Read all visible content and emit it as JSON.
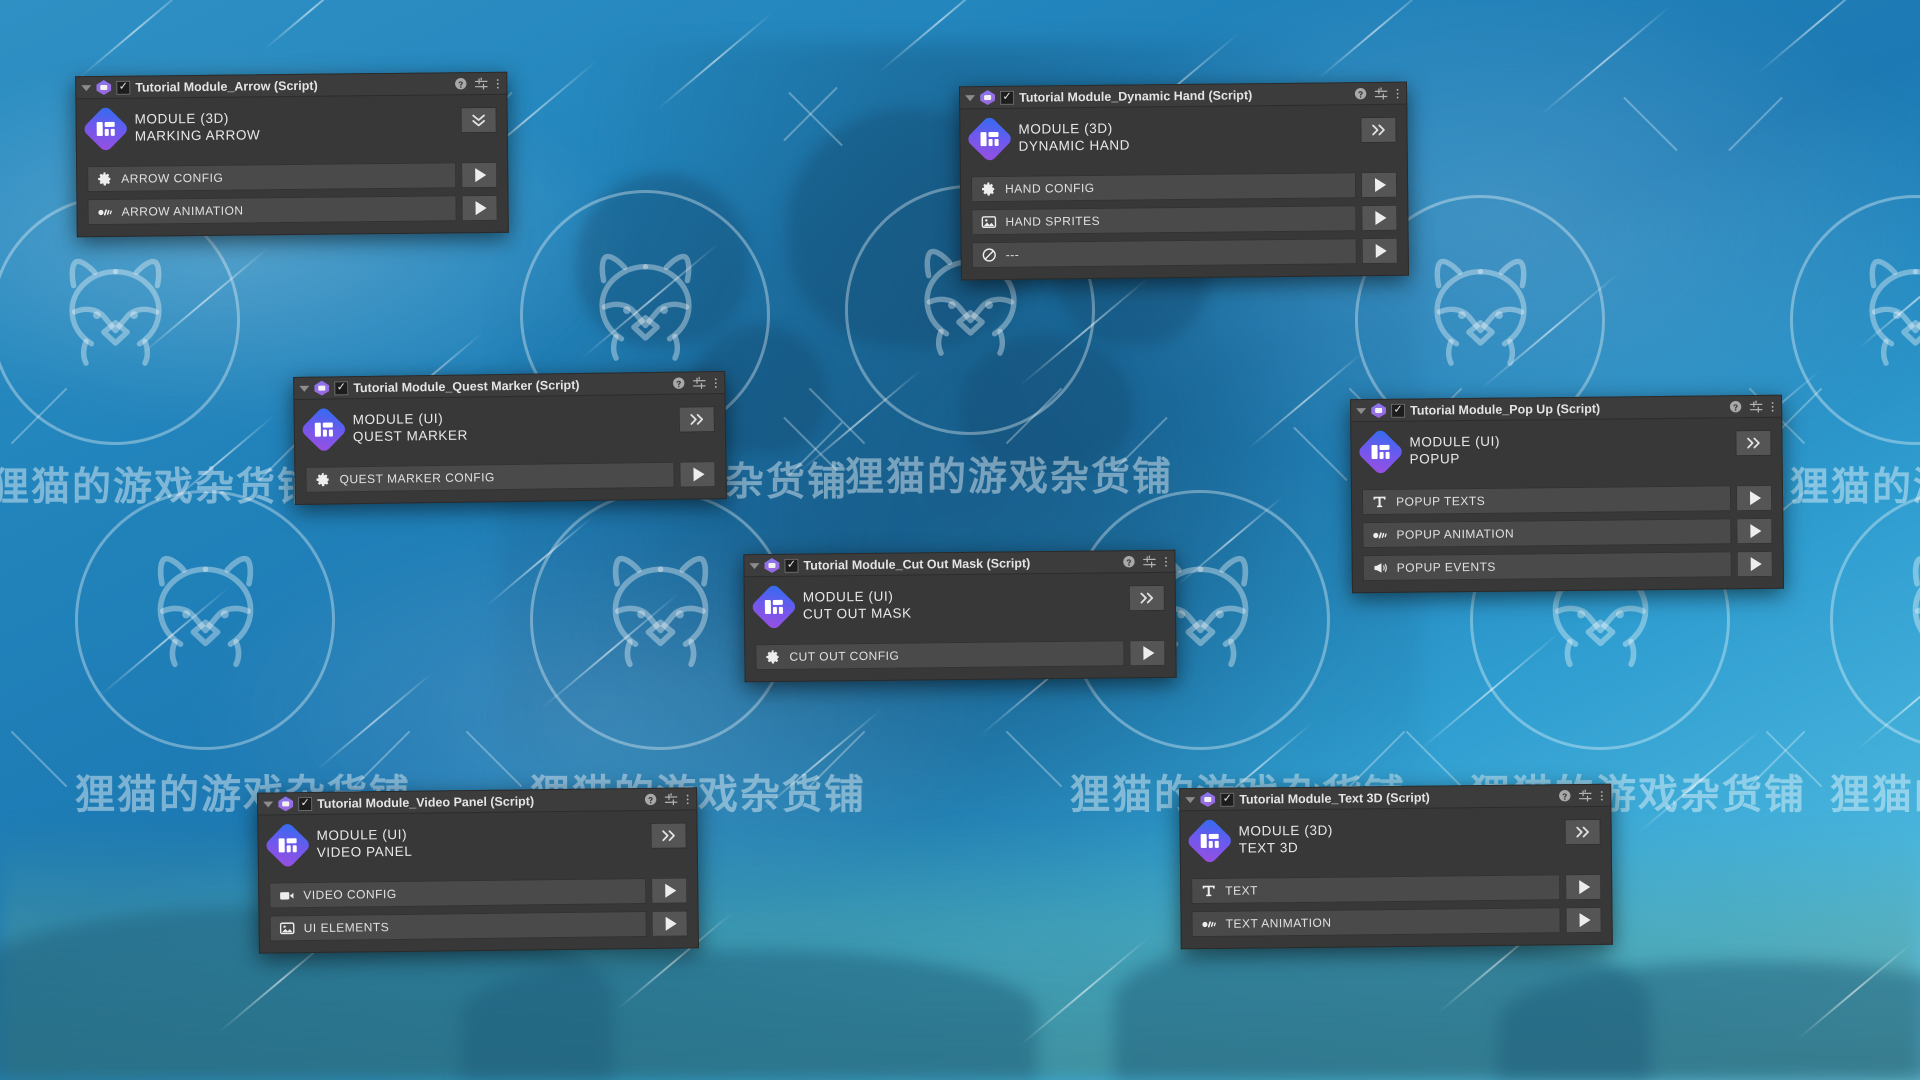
{
  "background": {
    "gradient_from": "#2f90c4",
    "gradient_to": "#6cc4df",
    "watermark_text": "狸猫的游戏杂货铺",
    "watermark_icon": "raccoon-face-icon"
  },
  "panels": [
    {
      "id": "arrow",
      "header": {
        "title": "Tutorial Module_Arrow (Script)",
        "enabled_check": "✓",
        "help_icon": "help-icon",
        "preset_icon": "preset-sliders-icon",
        "menu_icon": "kebab-menu-icon"
      },
      "module": {
        "kind": "MODULE (3D)",
        "name": "MARKING ARROW",
        "collapse_icon": "chevron-double-down-icon"
      },
      "sections": [
        {
          "label": "ARROW CONFIG",
          "icon": "gear-icon"
        },
        {
          "label": "ARROW ANIMATION",
          "icon": "motion-icon"
        }
      ]
    },
    {
      "id": "dynamic-hand",
      "header": {
        "title": "Tutorial Module_Dynamic Hand (Script)",
        "enabled_check": "✓",
        "help_icon": "help-icon",
        "preset_icon": "preset-sliders-icon",
        "menu_icon": "kebab-menu-icon"
      },
      "module": {
        "kind": "MODULE (3D)",
        "name": "DYNAMIC HAND",
        "collapse_icon": "chevron-double-right-icon"
      },
      "sections": [
        {
          "label": "HAND CONFIG",
          "icon": "gear-icon"
        },
        {
          "label": "HAND SPRITES",
          "icon": "image-icon"
        },
        {
          "label": "---",
          "icon": "prohibited-icon"
        }
      ]
    },
    {
      "id": "quest-marker",
      "header": {
        "title": "Tutorial Module_Quest Marker (Script)",
        "enabled_check": "✓",
        "help_icon": "help-icon",
        "preset_icon": "preset-sliders-icon",
        "menu_icon": "kebab-menu-icon"
      },
      "module": {
        "kind": "MODULE (UI)",
        "name": "QUEST MARKER",
        "collapse_icon": "chevron-double-right-icon"
      },
      "sections": [
        {
          "label": "QUEST MARKER CONFIG",
          "icon": "gear-icon"
        }
      ]
    },
    {
      "id": "pop-up",
      "header": {
        "title": "Tutorial Module_Pop Up (Script)",
        "enabled_check": "✓",
        "help_icon": "help-icon",
        "preset_icon": "preset-sliders-icon",
        "menu_icon": "kebab-menu-icon"
      },
      "module": {
        "kind": "MODULE (UI)",
        "name": "POPUP",
        "collapse_icon": "chevron-double-right-icon"
      },
      "sections": [
        {
          "label": "POPUP TEXTS",
          "icon": "text-icon"
        },
        {
          "label": "POPUP ANIMATION",
          "icon": "motion-icon"
        },
        {
          "label": "POPUP EVENTS",
          "icon": "megaphone-icon"
        }
      ]
    },
    {
      "id": "cut-out-mask",
      "header": {
        "title": "Tutorial Module_Cut Out Mask (Script)",
        "enabled_check": "✓",
        "help_icon": "help-icon",
        "preset_icon": "preset-sliders-icon",
        "menu_icon": "kebab-menu-icon"
      },
      "module": {
        "kind": "MODULE (UI)",
        "name": "CUT OUT MASK",
        "collapse_icon": "chevron-double-right-icon"
      },
      "sections": [
        {
          "label": "CUT OUT CONFIG",
          "icon": "gear-icon"
        }
      ]
    },
    {
      "id": "video-panel",
      "header": {
        "title": "Tutorial Module_Video Panel (Script)",
        "enabled_check": "✓",
        "help_icon": "help-icon",
        "preset_icon": "preset-sliders-icon",
        "menu_icon": "kebab-menu-icon"
      },
      "module": {
        "kind": "MODULE (UI)",
        "name": "VIDEO PANEL",
        "collapse_icon": "chevron-double-right-icon"
      },
      "sections": [
        {
          "label": "VIDEO CONFIG",
          "icon": "video-camera-icon"
        },
        {
          "label": "UI ELEMENTS",
          "icon": "image-icon"
        }
      ]
    },
    {
      "id": "text-3d",
      "header": {
        "title": "Tutorial Module_Text 3D (Script)",
        "enabled_check": "✓",
        "help_icon": "help-icon",
        "preset_icon": "preset-sliders-icon",
        "menu_icon": "kebab-menu-icon"
      },
      "module": {
        "kind": "MODULE (3D)",
        "name": "TEXT 3D",
        "collapse_icon": "chevron-double-right-icon"
      },
      "sections": [
        {
          "label": "TEXT",
          "icon": "text-icon"
        },
        {
          "label": "TEXT ANIMATION",
          "icon": "motion-icon"
        }
      ]
    }
  ]
}
